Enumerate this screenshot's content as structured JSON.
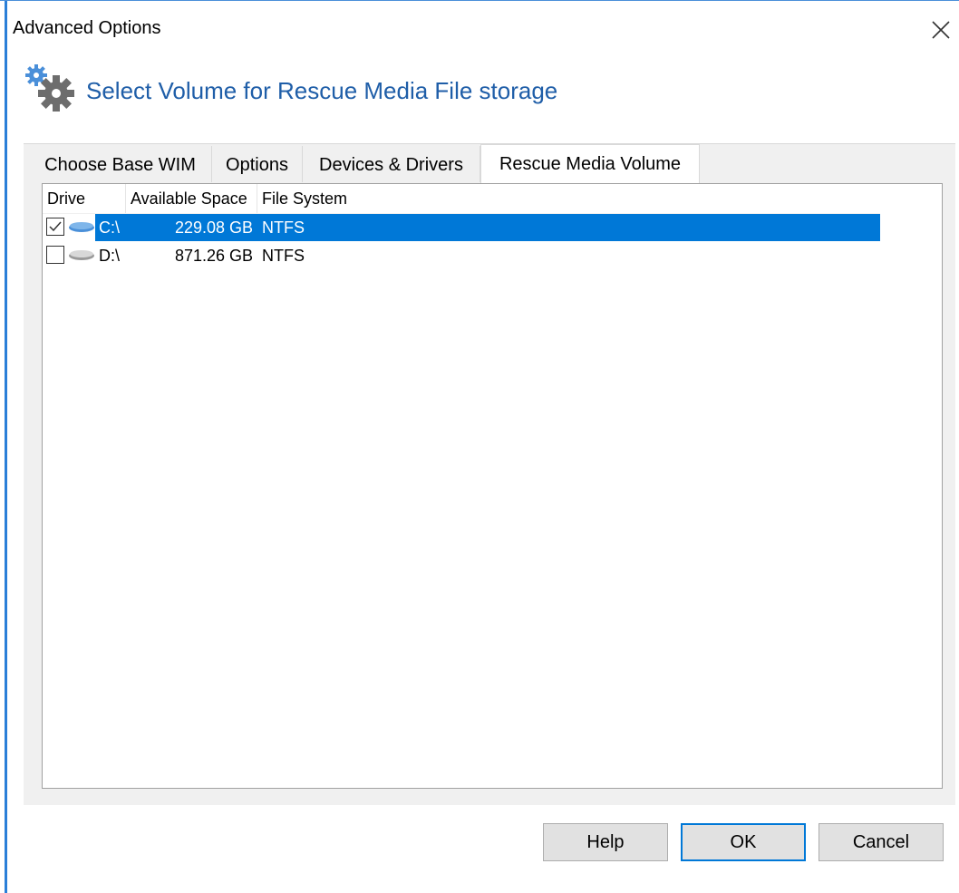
{
  "window": {
    "title": "Advanced Options"
  },
  "header": {
    "title": "Select Volume for Rescue Media File storage",
    "icon": "gears-icon"
  },
  "tabs": [
    {
      "label": "Choose Base WIM",
      "active": false
    },
    {
      "label": "Options",
      "active": false
    },
    {
      "label": "Devices & Drivers",
      "active": false
    },
    {
      "label": "Rescue Media Volume",
      "active": true
    }
  ],
  "list": {
    "columns": [
      "Drive",
      "Available Space",
      "File System"
    ],
    "rows": [
      {
        "drive": "C:\\",
        "space": "229.08 GB",
        "fs": "NTFS",
        "checked": true,
        "selected": true
      },
      {
        "drive": "D:\\",
        "space": "871.26 GB",
        "fs": "NTFS",
        "checked": false,
        "selected": false
      }
    ]
  },
  "buttons": {
    "help": "Help",
    "ok": "OK",
    "cancel": "Cancel"
  },
  "colors": {
    "accent": "#0078d7",
    "header_text": "#1f5ea8"
  }
}
